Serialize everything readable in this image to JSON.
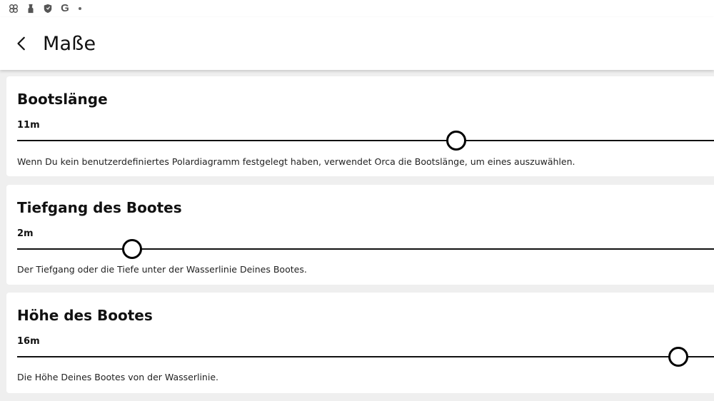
{
  "status_bar": {
    "icons": [
      "pinwheel-icon",
      "lock-icon",
      "shield-icon",
      "google-icon",
      "dot-icon"
    ],
    "google_letter": "G"
  },
  "app_bar": {
    "back_icon": "chevron-left-icon",
    "title": "Maße"
  },
  "settings": [
    {
      "title": "Bootslänge",
      "value": "11m",
      "slider_level": 0.63,
      "description": "Wenn Du kein benutzerdefiniertes Polardiagramm festgelegt haben, verwendet Orca die Bootslänge, um eines auszuwählen."
    },
    {
      "title": "Tiefgang des Bootes",
      "value": "2m",
      "slider_level": 0.165,
      "description": "Der Tiefgang oder die Tiefe unter der Wasserlinie Deines Bootes."
    },
    {
      "title": "Höhe des Bootes",
      "value": "16m",
      "slider_level": 0.949,
      "description": "Die Höhe Deines Bootes von der Wasserlinie."
    }
  ],
  "colors": {
    "background": "#efefef",
    "card": "#ffffff",
    "text": "#111111",
    "slider": "#000000"
  }
}
